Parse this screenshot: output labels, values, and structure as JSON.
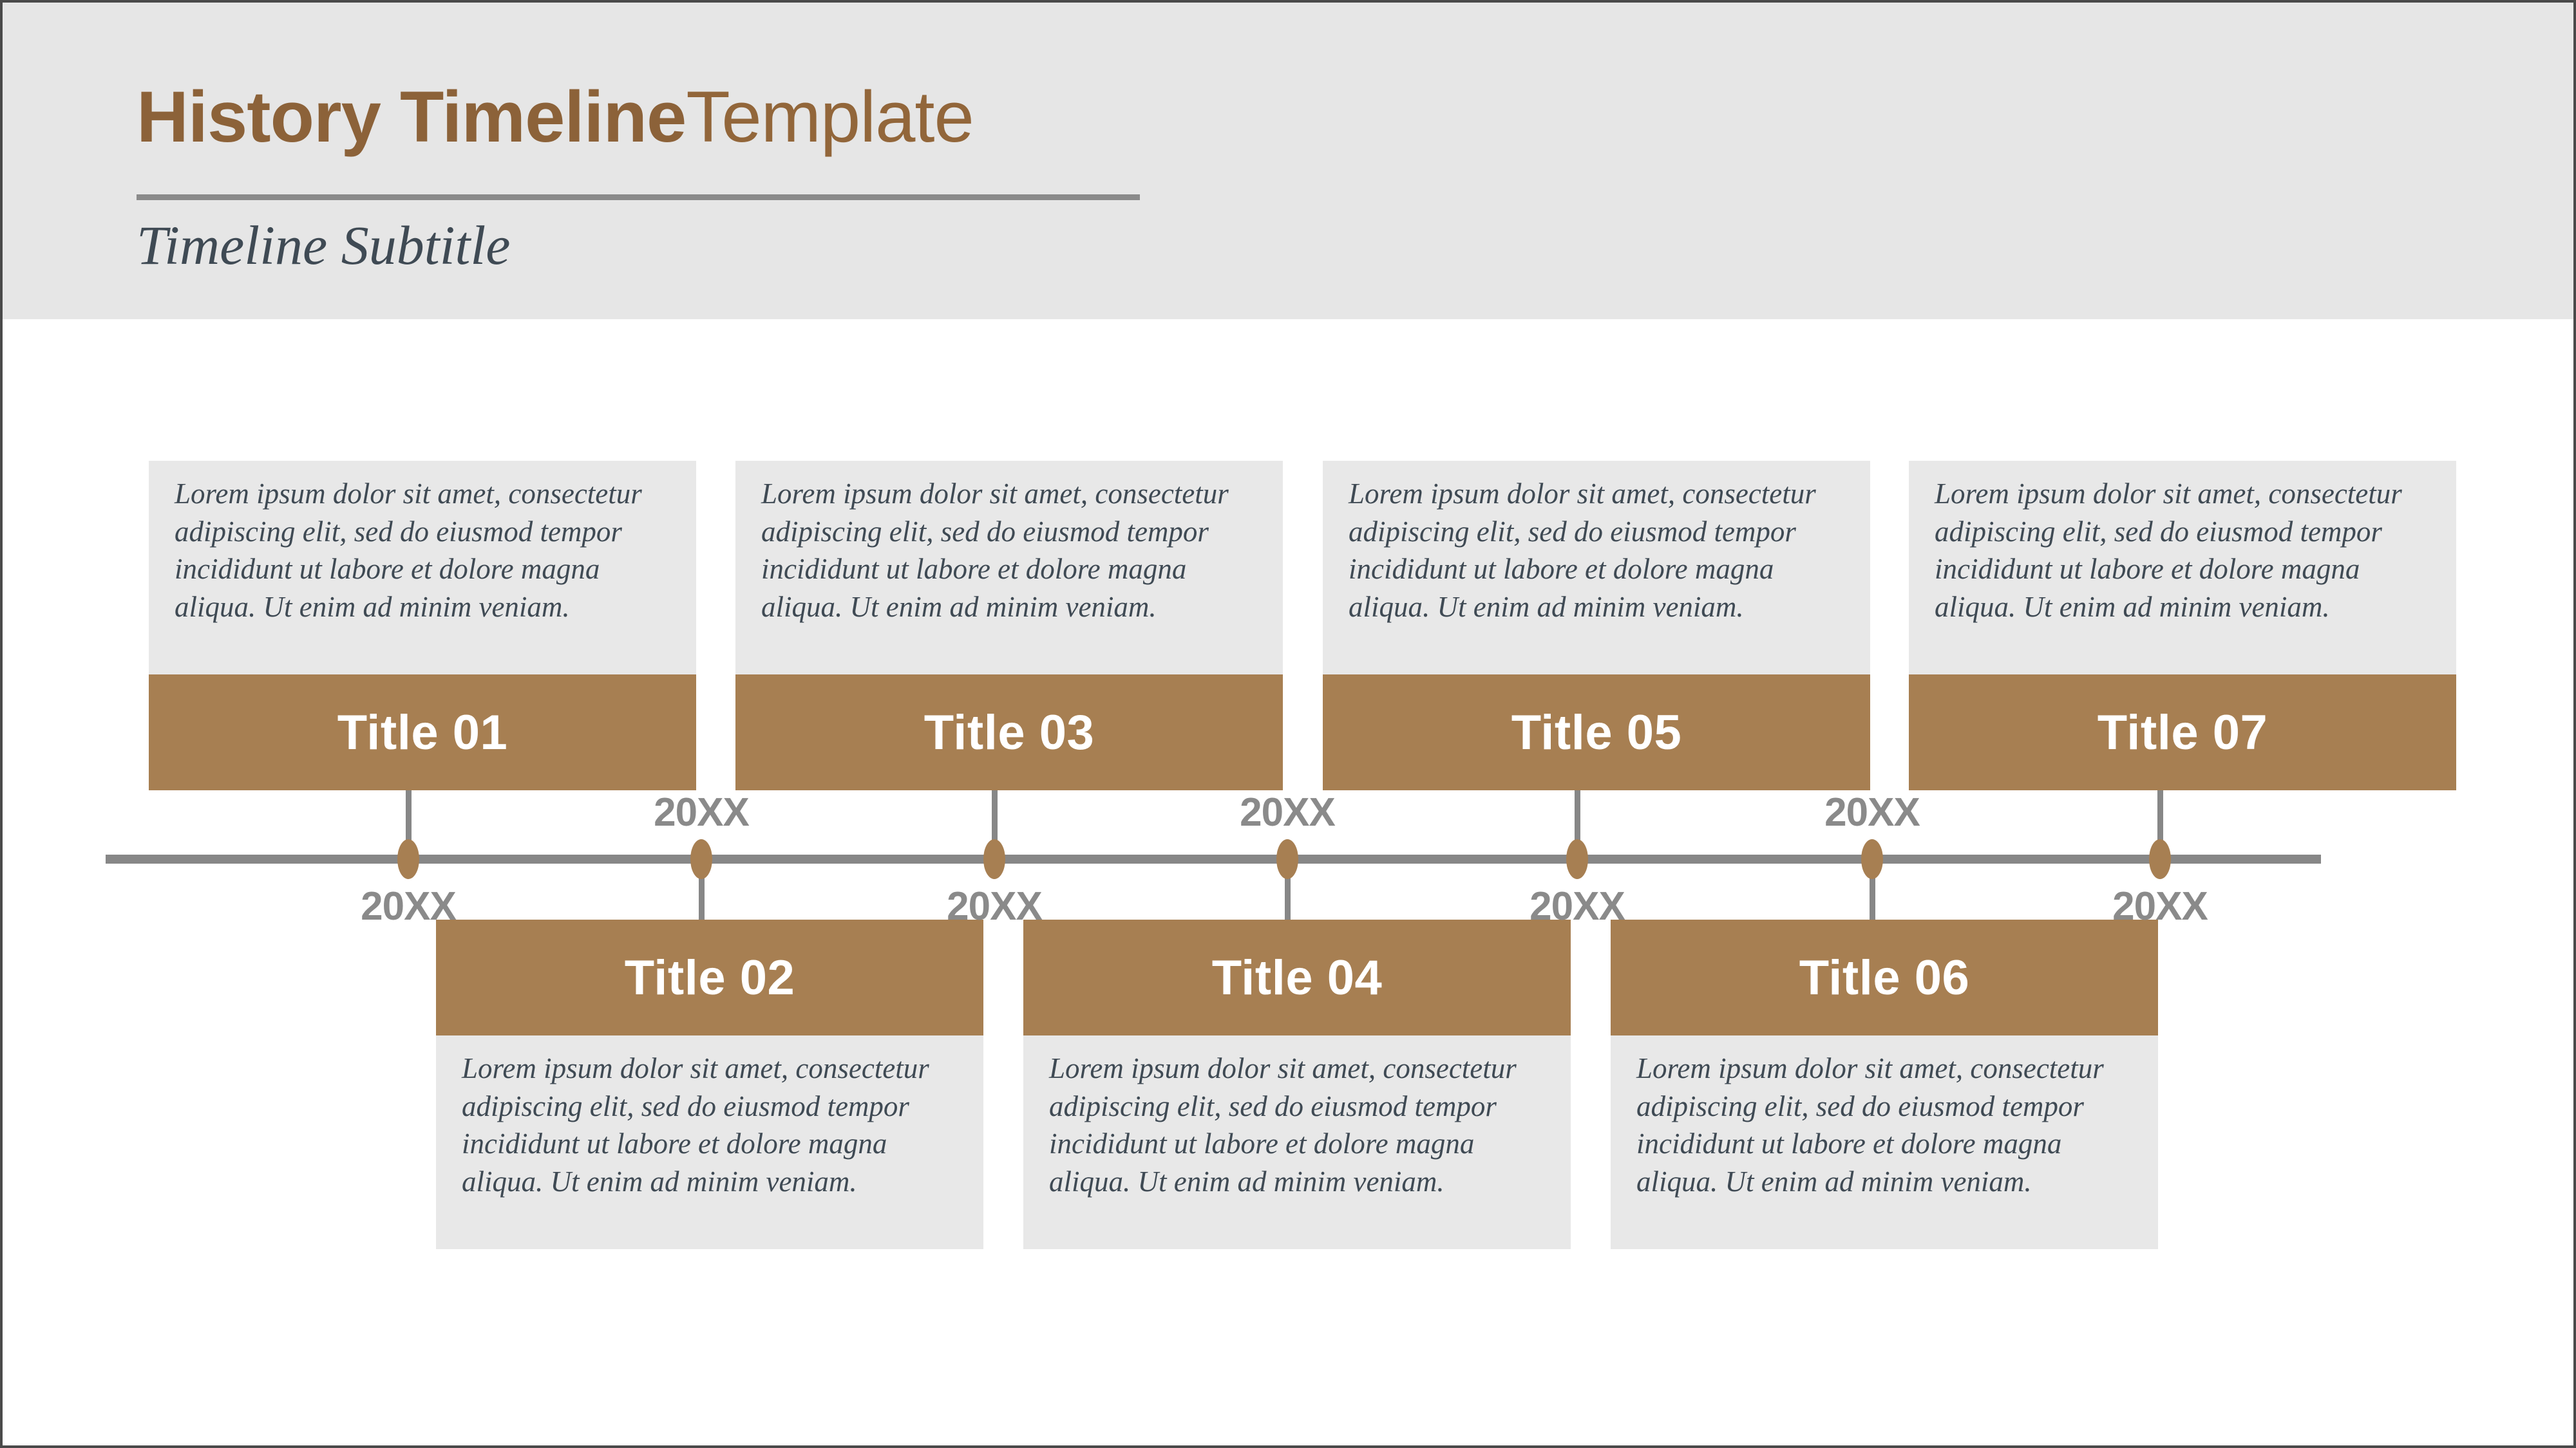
{
  "header": {
    "title_strong": "History Timeline",
    "title_light": "Template",
    "subtitle": "Timeline Subtitle"
  },
  "body_text": "Lorem ipsum dolor sit amet, consectetur adipiscing elit, sed do eiusmod tempor incididunt ut labore et dolore magna aliqua. Ut enim ad minim veniam.",
  "colors": {
    "accent_brown": "#a77f52",
    "title_brown": "#8c6239",
    "panel_gray": "#e8e8e8",
    "header_gray": "#e6e6e6",
    "axis_gray": "#878787",
    "text_slate": "#3f4a54",
    "year_gray": "#8a8a8a"
  },
  "milestones": [
    {
      "title": "Title 01",
      "year": "20XX",
      "position": "top",
      "body": "Lorem ipsum dolor sit amet, consectetur adipiscing elit, sed do eiusmod tempor incididunt ut labore et dolore magna aliqua. Ut enim ad minim veniam."
    },
    {
      "title": "Title 02",
      "year": "20XX",
      "position": "bottom",
      "body": "Lorem ipsum dolor sit amet, consectetur adipiscing elit, sed do eiusmod tempor incididunt ut labore et dolore magna aliqua. Ut enim ad minim veniam."
    },
    {
      "title": "Title 03",
      "year": "20XX",
      "position": "top",
      "body": "Lorem ipsum dolor sit amet, consectetur adipiscing elit, sed do eiusmod tempor incididunt ut labore et dolore magna aliqua. Ut enim ad minim veniam."
    },
    {
      "title": "Title 04",
      "year": "20XX",
      "position": "bottom",
      "body": "Lorem ipsum dolor sit amet, consectetur adipiscing elit, sed do eiusmod tempor incididunt ut labore et dolore magna aliqua. Ut enim ad minim veniam."
    },
    {
      "title": "Title 05",
      "year": "20XX",
      "position": "top",
      "body": "Lorem ipsum dolor sit amet, consectetur adipiscing elit, sed do eiusmod tempor incididunt ut labore et dolore magna aliqua. Ut enim ad minim veniam."
    },
    {
      "title": "Title 06",
      "year": "20XX",
      "position": "bottom",
      "body": "Lorem ipsum dolor sit amet, consectetur adipiscing elit, sed do eiusmod tempor incididunt ut labore et dolore magna aliqua. Ut enim ad minim veniam."
    },
    {
      "title": "Title 07",
      "year": "20XX",
      "position": "top",
      "body": "Lorem ipsum dolor sit amet, consectetur adipiscing elit, sed do eiusmod tempor incididunt ut labore et dolore magna aliqua. Ut enim ad minim veniam."
    }
  ]
}
